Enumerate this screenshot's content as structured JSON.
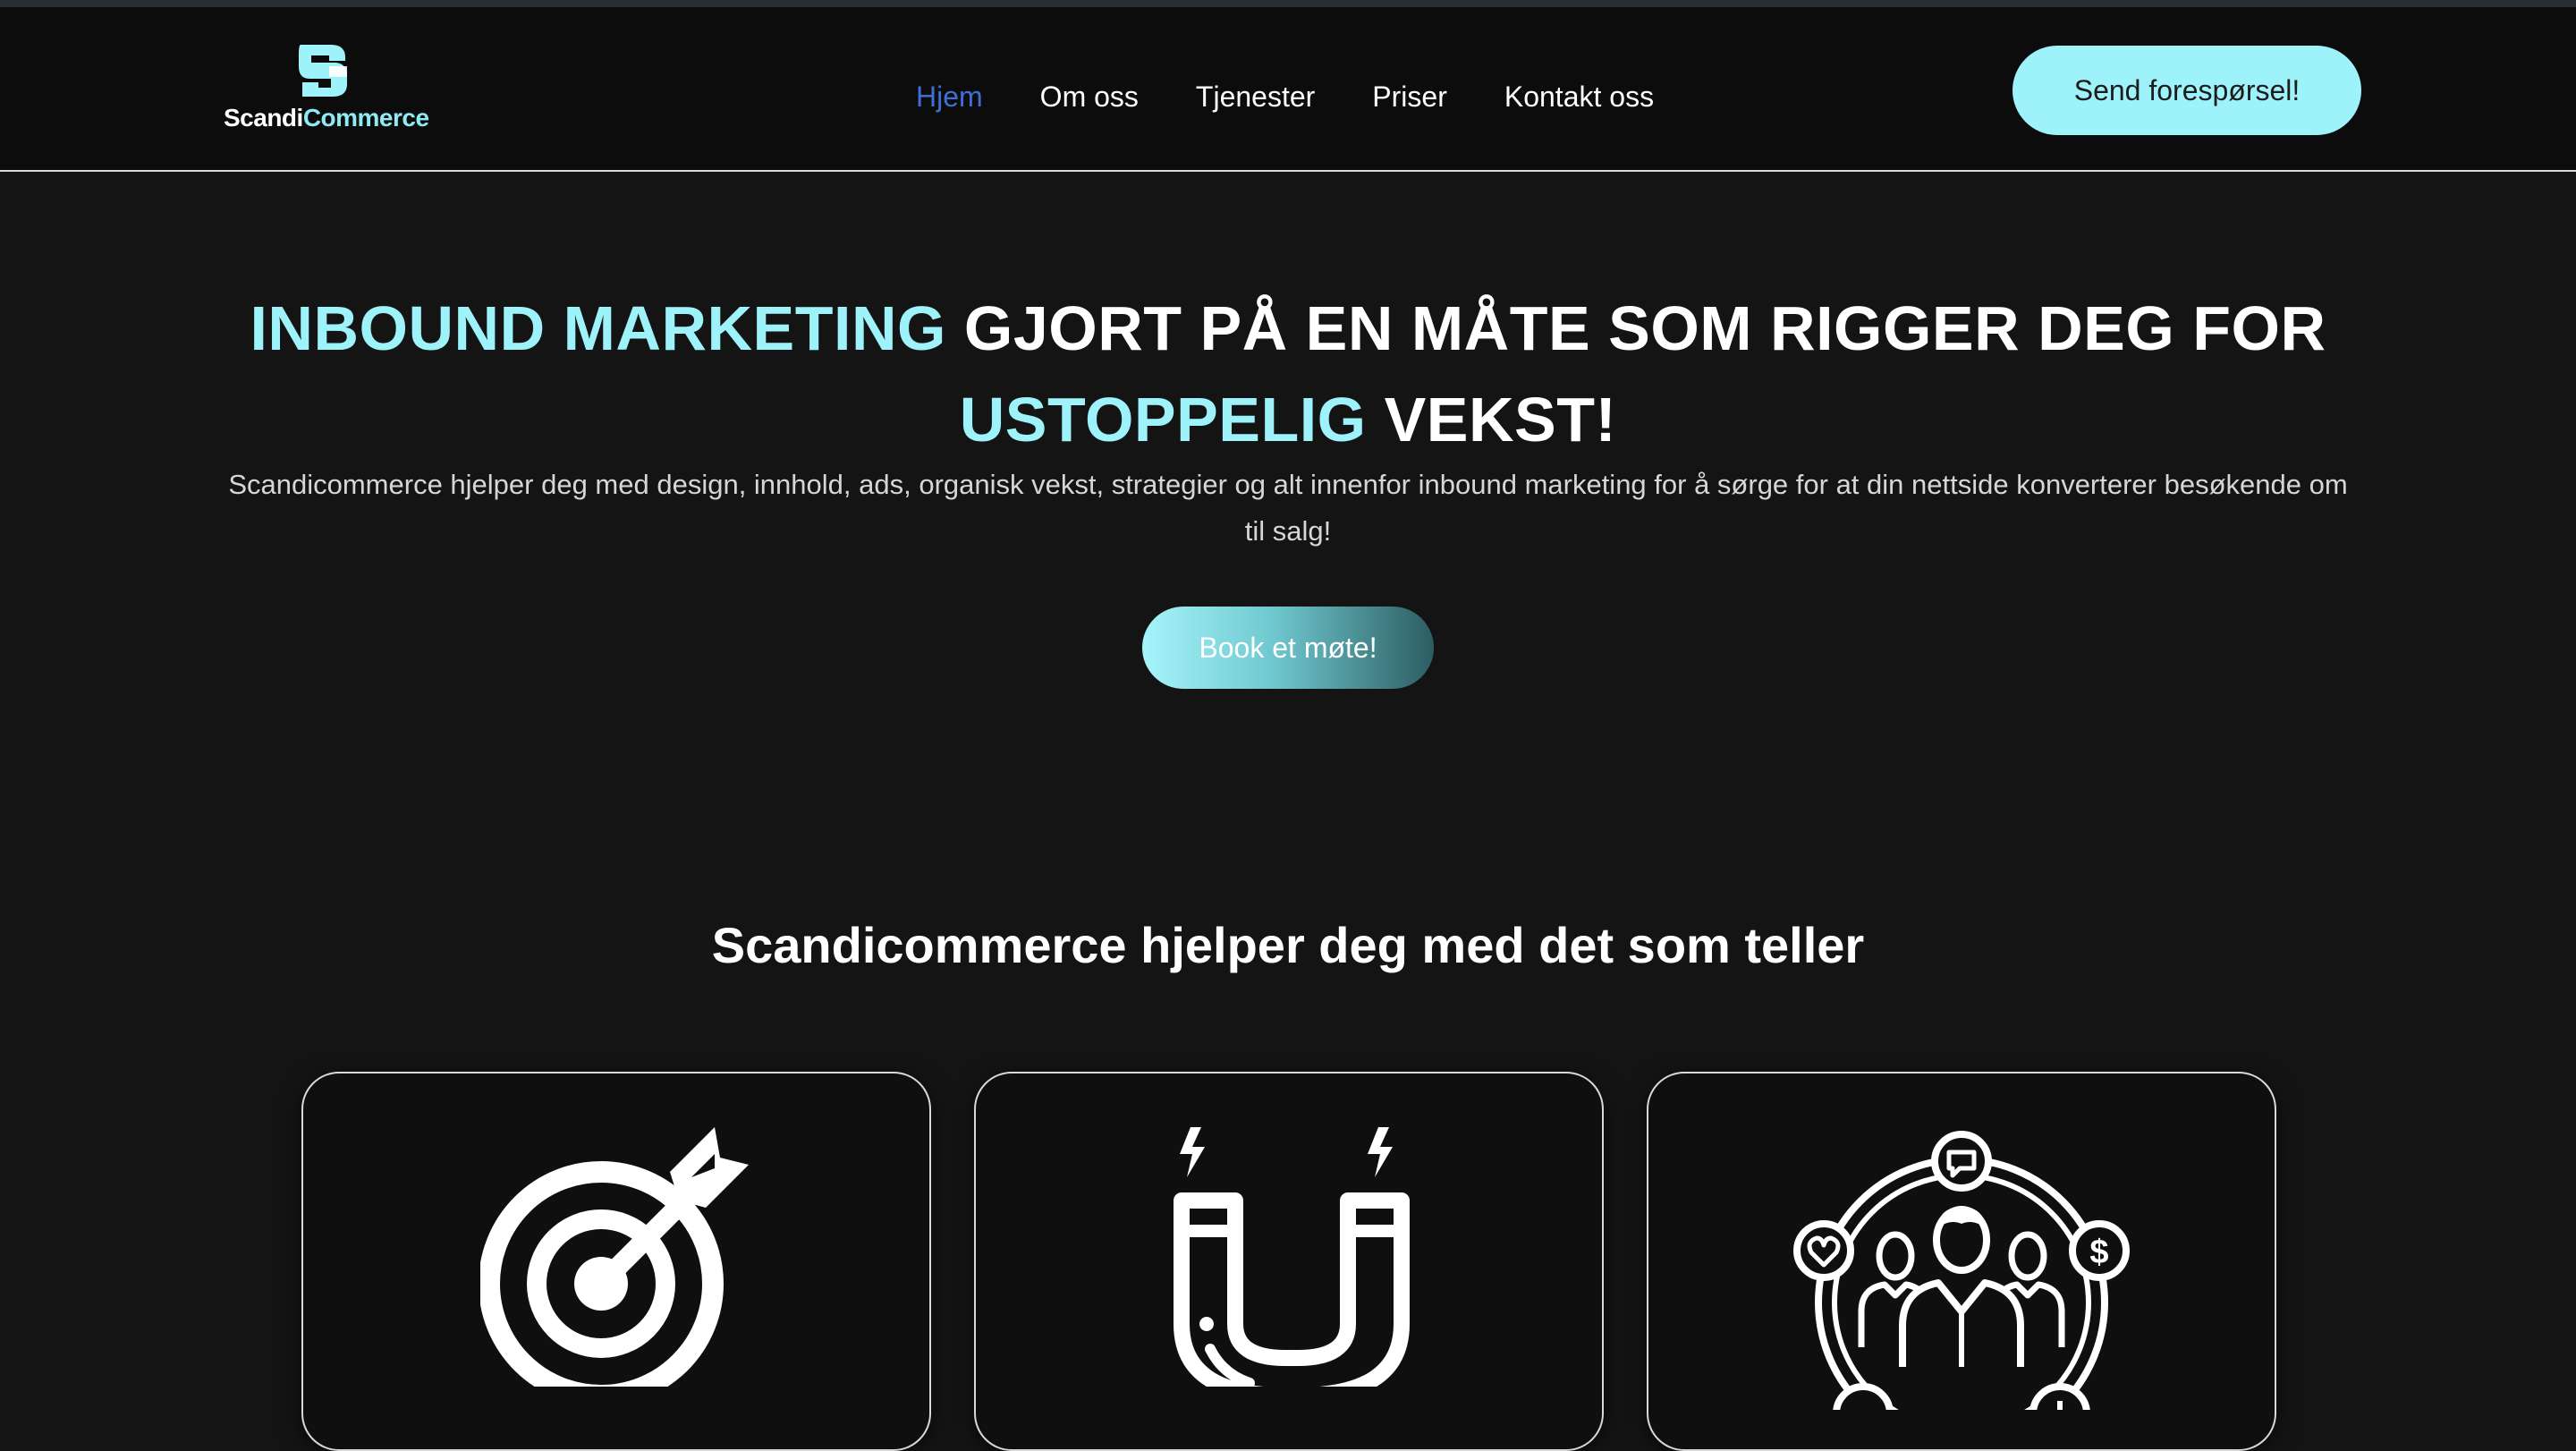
{
  "logo": {
    "part1": "Scandi",
    "part2": "Commerce"
  },
  "nav": {
    "items": [
      {
        "label": "Hjem",
        "active": true
      },
      {
        "label": "Om oss"
      },
      {
        "label": "Tjenester"
      },
      {
        "label": "Priser"
      },
      {
        "label": "Kontakt oss"
      }
    ]
  },
  "header": {
    "cta_label": "Send forespørsel!"
  },
  "hero": {
    "title_accent1": "INBOUND MARKETING",
    "title_mid": " GJORT PÅ EN MÅTE SOM RIGGER DEG FOR ",
    "title_accent2": "USTOPPELIG",
    "title_end": " VEKST!",
    "subtitle": "Scandicommerce hjelper deg med design, innhold, ads, organisk vekst, strategier og alt innenfor inbound marketing for å sørge for at din nettside konverterer besøkende om til salg!",
    "cta_label": "Book et møte!"
  },
  "services": {
    "title": "Scandicommerce hjelper deg med det som teller",
    "cards": [
      {
        "icon": "target-arrow-icon"
      },
      {
        "icon": "magnet-icon"
      },
      {
        "icon": "audience-network-icon"
      }
    ]
  },
  "colors": {
    "accent": "#9ef3fb",
    "background": "#141414",
    "header_bg": "#0c0c0c",
    "nav_active": "#3f6fd6"
  }
}
